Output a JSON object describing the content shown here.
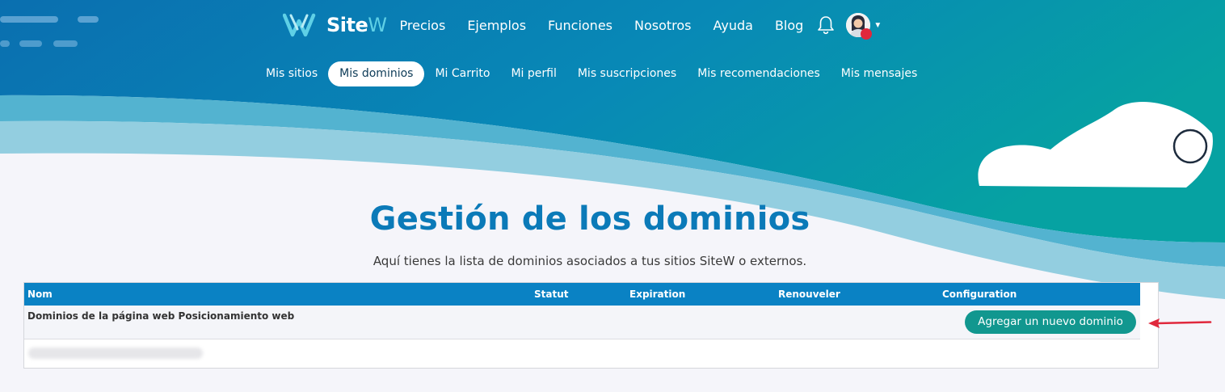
{
  "brand": {
    "logo_text": "Site",
    "logo_accent": "W"
  },
  "nav": {
    "items": [
      "Precios",
      "Ejemplos",
      "Funciones",
      "Nosotros",
      "Ayuda",
      "Blog"
    ]
  },
  "account_menu": {
    "items": [
      "Mis sitios",
      "Mis dominios",
      "Mi Carrito",
      "Mi perfil",
      "Mis suscripciones",
      "Mis recomendaciones",
      "Mis mensajes"
    ],
    "active": "Mis dominios"
  },
  "page": {
    "title": "Gestión de los dominios",
    "subtitle": "Aquí tienes la lista de dominios asociados a tus sitios SiteW o externos."
  },
  "table": {
    "columns": [
      "Nom",
      "Statut",
      "Expiration",
      "Renouveler",
      "Configuration"
    ],
    "group_label": "Dominios de la página web Posicionamiento web",
    "add_button": "Agregar un nuevo dominio"
  },
  "colors": {
    "hero_start": "#0a6fb0",
    "hero_end": "#07a1a2",
    "title": "#0b7ab8",
    "table_header": "#0a82c4",
    "button": "#11978f",
    "annotation_arrow": "#e0283c",
    "notification_dot": "#e0283c"
  },
  "icons": {
    "bell": "bell-icon",
    "avatar": "user-avatar",
    "caret": "caret-down-icon",
    "arrow": "annotation-arrow-icon"
  }
}
